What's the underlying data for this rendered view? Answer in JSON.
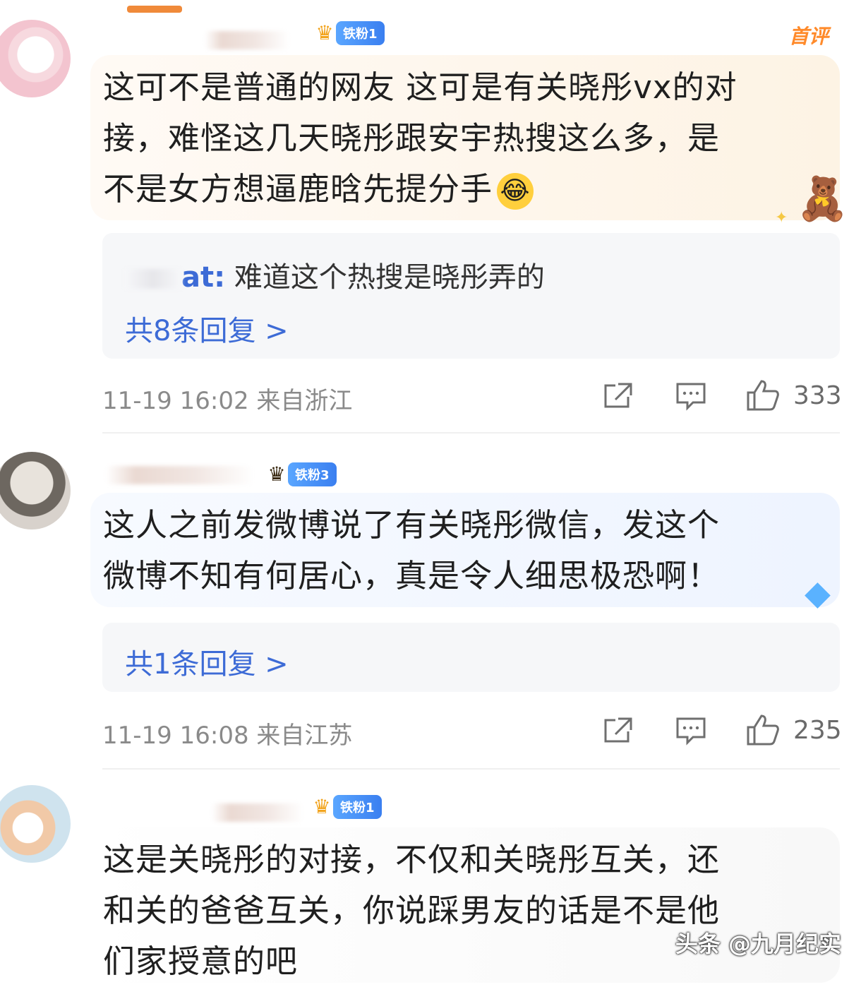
{
  "comments": [
    {
      "badge": "铁粉1",
      "tag": "首评",
      "text_lines": [
        "这可不是普通的网友 这可是有关晓彤vx的对",
        "接，难怪这几天晓彤跟安宇热搜这么多，是",
        "不是女方想逼鹿晗先提分手"
      ],
      "emoji": "😂",
      "reply_preview": {
        "author_suffix": "at:",
        "text": "难道这个热搜是晓彤弄的"
      },
      "reply_more": "共8条回复 >",
      "time_location": "11-19 16:02 来自浙江",
      "likes": "333"
    },
    {
      "badge": "铁粉3",
      "text_lines": [
        "这人之前发微博说了有关晓彤微信，发这个",
        "微博不知有何居心，真是令人细思极恐啊！"
      ],
      "reply_more": "共1条回复 >",
      "time_location": "11-19 16:08 来自江苏",
      "likes": "235"
    },
    {
      "badge": "铁粉1",
      "text_lines": [
        "这是关晓彤的对接，不仅和关晓彤互关，还",
        "和关的爸爸互关，你说踩男友的话是不是他",
        "们家授意的吧"
      ]
    }
  ],
  "watermark": "头条 @九月纪实",
  "icons": {
    "share": "share-icon",
    "comment": "comment-icon",
    "like": "thumbs-up-icon",
    "crown": "crown-icon"
  },
  "colors": {
    "link_blue": "#3d6bd6",
    "badge_blue": "#3a7ff0",
    "first_tag_orange": "#ff8a2a"
  }
}
